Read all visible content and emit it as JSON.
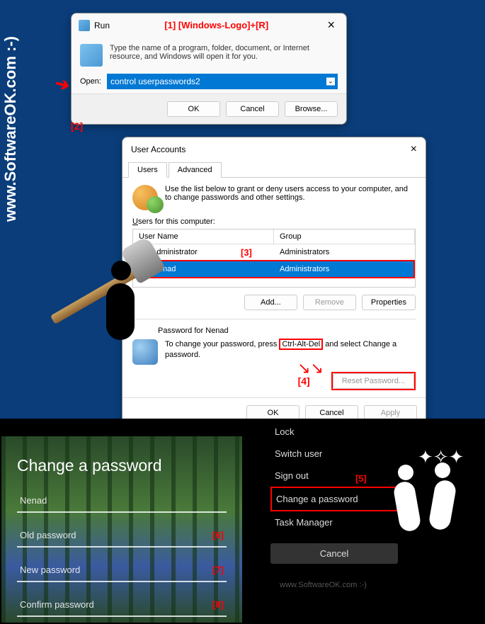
{
  "site_watermark": "www.SoftwareOK.com :-)",
  "vertical_label": "www.SoftwareOK.com :-)",
  "annotations": {
    "a1": "[1] [Windows-Logo]+[R]",
    "a2": "[2]",
    "a3": "[3]",
    "a4": "[4]",
    "a5": "[5]",
    "a6": "[6]",
    "a7": "[7]",
    "a8": "[8]"
  },
  "run_dialog": {
    "title": "Run",
    "description": "Type the name of a program, folder, document, or Internet resource, and Windows will open it for you.",
    "open_label": "Open:",
    "input_value": "control userpasswords2",
    "buttons": {
      "ok": "OK",
      "cancel": "Cancel",
      "browse": "Browse..."
    }
  },
  "user_accounts": {
    "title": "User Accounts",
    "tabs": {
      "users": "Users",
      "advanced": "Advanced"
    },
    "instruction": "Use the list below to grant or deny users access to your computer, and to change passwords and other settings.",
    "users_label": "Users for this computer:",
    "columns": {
      "name": "User Name",
      "group": "Group"
    },
    "rows": [
      {
        "name": "Administrator",
        "group": "Administrators"
      },
      {
        "name": "Nenad",
        "group": "Administrators"
      }
    ],
    "action_buttons": {
      "add": "Add...",
      "remove": "Remove",
      "properties": "Properties"
    },
    "pw_section_title": "Password for Nenad",
    "pw_text_prefix": "To change your password, press ",
    "pw_keys": "Ctrl-Alt-Del",
    "pw_text_suffix": " and select Change a password.",
    "reset_button": "Reset Password...",
    "bottom_buttons": {
      "ok": "OK",
      "cancel": "Cancel",
      "apply": "Apply"
    }
  },
  "cad_menu": {
    "lock": "Lock",
    "switch": "Switch user",
    "signout": "Sign out",
    "change": "Change a password",
    "taskmgr": "Task Manager",
    "cancel": "Cancel"
  },
  "change_password": {
    "title": "Change a password",
    "username": "Nenad",
    "old": "Old password",
    "new": "New password",
    "confirm": "Confirm password"
  }
}
